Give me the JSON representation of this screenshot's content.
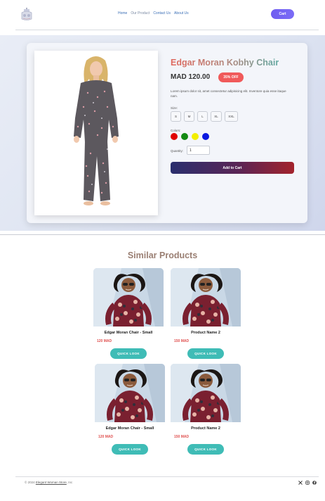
{
  "header": {
    "nav": [
      "Home",
      "Our Product",
      "Contact Us",
      "About Us"
    ],
    "cart_label": "Cart"
  },
  "product": {
    "title": "Edgar Moran Kobhy Chair",
    "price": "MAD 120.00",
    "discount": "35% OFF",
    "description": "Lorem ipsum dolor sit, amet consectetur adipisicing elit. Inventore quia esse itaque nam.",
    "size_label": "Size:",
    "sizes": [
      "S",
      "M",
      "L",
      "XL",
      "XXL"
    ],
    "colors_label": "Colors:",
    "colors": [
      "#e00000",
      "#138a13",
      "#f2ee00",
      "#0a18e0"
    ],
    "quantity_label": "Quantity:",
    "quantity_value": "1",
    "add_to_cart": "Add to Cart"
  },
  "similar": {
    "title": "Similar Products",
    "items": [
      {
        "name": "Edgar Moran Chair - Small",
        "price": "120 MAD",
        "action": "QUICK LOOK"
      },
      {
        "name": "Product Name 2",
        "price": "150 MAD",
        "action": "QUICK LOOK"
      },
      {
        "name": "Edgar Moran Chair - Small",
        "price": "120 MAD",
        "action": "QUICK LOOK"
      },
      {
        "name": "Product Name 2",
        "price": "150 MAD",
        "action": "QUICK LOOK"
      }
    ]
  },
  "footer": {
    "prefix": "© 2024",
    "store": "Elegant Woman Store",
    "suffix": ", Inc",
    "social_icons": [
      "x-icon",
      "instagram-icon",
      "facebook-icon"
    ]
  }
}
